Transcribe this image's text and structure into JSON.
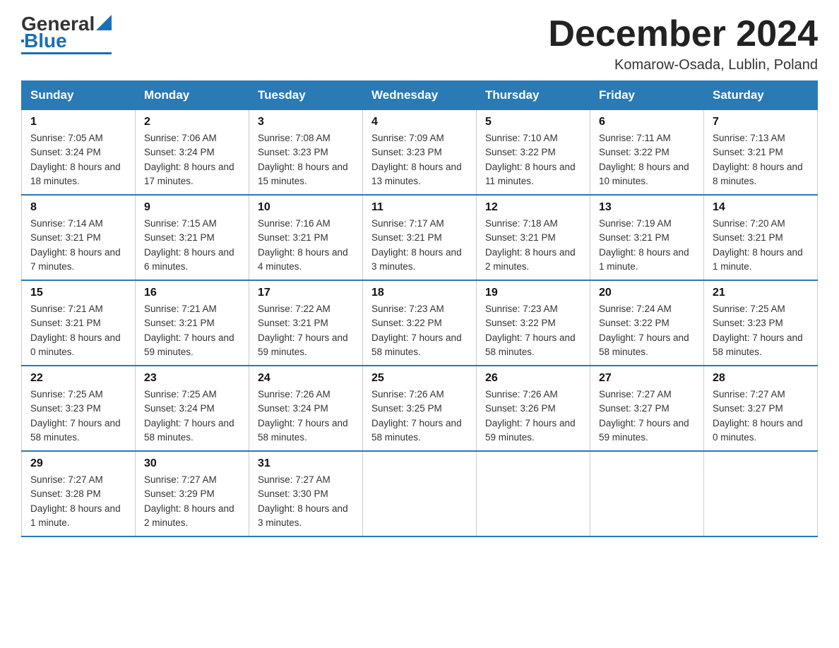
{
  "logo": {
    "text_general": "General",
    "text_blue": "Blue"
  },
  "title": "December 2024",
  "location": "Komarow-Osada, Lublin, Poland",
  "days_of_week": [
    "Sunday",
    "Monday",
    "Tuesday",
    "Wednesday",
    "Thursday",
    "Friday",
    "Saturday"
  ],
  "weeks": [
    [
      {
        "day": "1",
        "sunrise": "Sunrise: 7:05 AM",
        "sunset": "Sunset: 3:24 PM",
        "daylight": "Daylight: 8 hours and 18 minutes."
      },
      {
        "day": "2",
        "sunrise": "Sunrise: 7:06 AM",
        "sunset": "Sunset: 3:24 PM",
        "daylight": "Daylight: 8 hours and 17 minutes."
      },
      {
        "day": "3",
        "sunrise": "Sunrise: 7:08 AM",
        "sunset": "Sunset: 3:23 PM",
        "daylight": "Daylight: 8 hours and 15 minutes."
      },
      {
        "day": "4",
        "sunrise": "Sunrise: 7:09 AM",
        "sunset": "Sunset: 3:23 PM",
        "daylight": "Daylight: 8 hours and 13 minutes."
      },
      {
        "day": "5",
        "sunrise": "Sunrise: 7:10 AM",
        "sunset": "Sunset: 3:22 PM",
        "daylight": "Daylight: 8 hours and 11 minutes."
      },
      {
        "day": "6",
        "sunrise": "Sunrise: 7:11 AM",
        "sunset": "Sunset: 3:22 PM",
        "daylight": "Daylight: 8 hours and 10 minutes."
      },
      {
        "day": "7",
        "sunrise": "Sunrise: 7:13 AM",
        "sunset": "Sunset: 3:21 PM",
        "daylight": "Daylight: 8 hours and 8 minutes."
      }
    ],
    [
      {
        "day": "8",
        "sunrise": "Sunrise: 7:14 AM",
        "sunset": "Sunset: 3:21 PM",
        "daylight": "Daylight: 8 hours and 7 minutes."
      },
      {
        "day": "9",
        "sunrise": "Sunrise: 7:15 AM",
        "sunset": "Sunset: 3:21 PM",
        "daylight": "Daylight: 8 hours and 6 minutes."
      },
      {
        "day": "10",
        "sunrise": "Sunrise: 7:16 AM",
        "sunset": "Sunset: 3:21 PM",
        "daylight": "Daylight: 8 hours and 4 minutes."
      },
      {
        "day": "11",
        "sunrise": "Sunrise: 7:17 AM",
        "sunset": "Sunset: 3:21 PM",
        "daylight": "Daylight: 8 hours and 3 minutes."
      },
      {
        "day": "12",
        "sunrise": "Sunrise: 7:18 AM",
        "sunset": "Sunset: 3:21 PM",
        "daylight": "Daylight: 8 hours and 2 minutes."
      },
      {
        "day": "13",
        "sunrise": "Sunrise: 7:19 AM",
        "sunset": "Sunset: 3:21 PM",
        "daylight": "Daylight: 8 hours and 1 minute."
      },
      {
        "day": "14",
        "sunrise": "Sunrise: 7:20 AM",
        "sunset": "Sunset: 3:21 PM",
        "daylight": "Daylight: 8 hours and 1 minute."
      }
    ],
    [
      {
        "day": "15",
        "sunrise": "Sunrise: 7:21 AM",
        "sunset": "Sunset: 3:21 PM",
        "daylight": "Daylight: 8 hours and 0 minutes."
      },
      {
        "day": "16",
        "sunrise": "Sunrise: 7:21 AM",
        "sunset": "Sunset: 3:21 PM",
        "daylight": "Daylight: 7 hours and 59 minutes."
      },
      {
        "day": "17",
        "sunrise": "Sunrise: 7:22 AM",
        "sunset": "Sunset: 3:21 PM",
        "daylight": "Daylight: 7 hours and 59 minutes."
      },
      {
        "day": "18",
        "sunrise": "Sunrise: 7:23 AM",
        "sunset": "Sunset: 3:22 PM",
        "daylight": "Daylight: 7 hours and 58 minutes."
      },
      {
        "day": "19",
        "sunrise": "Sunrise: 7:23 AM",
        "sunset": "Sunset: 3:22 PM",
        "daylight": "Daylight: 7 hours and 58 minutes."
      },
      {
        "day": "20",
        "sunrise": "Sunrise: 7:24 AM",
        "sunset": "Sunset: 3:22 PM",
        "daylight": "Daylight: 7 hours and 58 minutes."
      },
      {
        "day": "21",
        "sunrise": "Sunrise: 7:25 AM",
        "sunset": "Sunset: 3:23 PM",
        "daylight": "Daylight: 7 hours and 58 minutes."
      }
    ],
    [
      {
        "day": "22",
        "sunrise": "Sunrise: 7:25 AM",
        "sunset": "Sunset: 3:23 PM",
        "daylight": "Daylight: 7 hours and 58 minutes."
      },
      {
        "day": "23",
        "sunrise": "Sunrise: 7:25 AM",
        "sunset": "Sunset: 3:24 PM",
        "daylight": "Daylight: 7 hours and 58 minutes."
      },
      {
        "day": "24",
        "sunrise": "Sunrise: 7:26 AM",
        "sunset": "Sunset: 3:24 PM",
        "daylight": "Daylight: 7 hours and 58 minutes."
      },
      {
        "day": "25",
        "sunrise": "Sunrise: 7:26 AM",
        "sunset": "Sunset: 3:25 PM",
        "daylight": "Daylight: 7 hours and 58 minutes."
      },
      {
        "day": "26",
        "sunrise": "Sunrise: 7:26 AM",
        "sunset": "Sunset: 3:26 PM",
        "daylight": "Daylight: 7 hours and 59 minutes."
      },
      {
        "day": "27",
        "sunrise": "Sunrise: 7:27 AM",
        "sunset": "Sunset: 3:27 PM",
        "daylight": "Daylight: 7 hours and 59 minutes."
      },
      {
        "day": "28",
        "sunrise": "Sunrise: 7:27 AM",
        "sunset": "Sunset: 3:27 PM",
        "daylight": "Daylight: 8 hours and 0 minutes."
      }
    ],
    [
      {
        "day": "29",
        "sunrise": "Sunrise: 7:27 AM",
        "sunset": "Sunset: 3:28 PM",
        "daylight": "Daylight: 8 hours and 1 minute."
      },
      {
        "day": "30",
        "sunrise": "Sunrise: 7:27 AM",
        "sunset": "Sunset: 3:29 PM",
        "daylight": "Daylight: 8 hours and 2 minutes."
      },
      {
        "day": "31",
        "sunrise": "Sunrise: 7:27 AM",
        "sunset": "Sunset: 3:30 PM",
        "daylight": "Daylight: 8 hours and 3 minutes."
      },
      null,
      null,
      null,
      null
    ]
  ]
}
